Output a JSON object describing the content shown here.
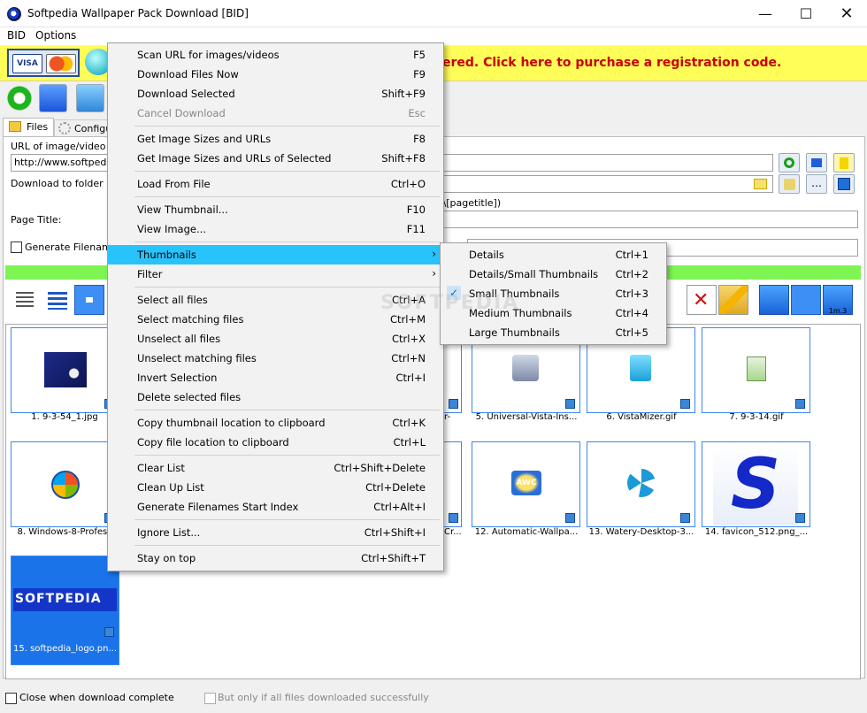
{
  "window": {
    "title": "Softpedia Wallpaper Pack Download [BID]"
  },
  "menubar": [
    "BID",
    "Options"
  ],
  "banner": {
    "text": "ered. Click here to purchase a registration code."
  },
  "tabs": {
    "files": "Files",
    "config": "Configu"
  },
  "form": {
    "url_label": "URL of image/video ga",
    "url_value": "http://www.softpedia",
    "folder_label": "Download to folder",
    "folder_pattern": "der]\\[pagetitle])",
    "page_title_label": "Page Title:",
    "generate_filenames_label": "Generate Filenames"
  },
  "thumbnails": [
    {
      "caption": "1. 9-3-54_1.jpg"
    },
    {
      "caption": "r-"
    },
    {
      "caption": "5. Universal-Vista-Ins..."
    },
    {
      "caption": "6. VistaMizer.gif"
    },
    {
      "caption": "7. 9-3-14.gif"
    },
    {
      "caption": "8. Windows-8-Profess"
    },
    {
      "caption": "Cr..."
    },
    {
      "caption": "12. Automatic-Wallpa..."
    },
    {
      "caption": "13. Watery-Desktop-3..."
    },
    {
      "caption": "14. favicon_512.png_..."
    },
    {
      "caption": "15. softpedia_logo.pn..."
    }
  ],
  "softpedia_logo_text": "SOFTPEDIA",
  "status": {
    "close_when_done": "Close when download complete",
    "only_if_success": "But only if all files downloaded successfully"
  },
  "context_menu": [
    {
      "label": "Scan URL for images/videos",
      "shortcut": "F5"
    },
    {
      "label": "Download Files Now",
      "shortcut": "F9"
    },
    {
      "label": "Download Selected",
      "shortcut": "Shift+F9"
    },
    {
      "label": "Cancel Download",
      "shortcut": "Esc"
    },
    {
      "label": "Get Image Sizes and URLs",
      "shortcut": "F8"
    },
    {
      "label": "Get Image Sizes and URLs of Selected",
      "shortcut": "Shift+F8"
    },
    {
      "label": "Load From File",
      "shortcut": "Ctrl+O"
    },
    {
      "label": "View Thumbnail...",
      "shortcut": "F10"
    },
    {
      "label": "View Image...",
      "shortcut": "F11"
    },
    {
      "label": "Thumbnails",
      "shortcut": ""
    },
    {
      "label": "Filter",
      "shortcut": ""
    },
    {
      "label": "Select all files",
      "shortcut": "Ctrl+A"
    },
    {
      "label": "Select matching files",
      "shortcut": "Ctrl+M"
    },
    {
      "label": "Unselect all files",
      "shortcut": "Ctrl+X"
    },
    {
      "label": "Unselect matching files",
      "shortcut": "Ctrl+N"
    },
    {
      "label": "Invert Selection",
      "shortcut": "Ctrl+I"
    },
    {
      "label": "Delete selected files",
      "shortcut": ""
    },
    {
      "label": "Copy thumbnail location to clipboard",
      "shortcut": "Ctrl+K"
    },
    {
      "label": "Copy file location to clipboard",
      "shortcut": "Ctrl+L"
    },
    {
      "label": "Clear List",
      "shortcut": "Ctrl+Shift+Delete"
    },
    {
      "label": "Clean Up List",
      "shortcut": "Ctrl+Delete"
    },
    {
      "label": "Generate Filenames Start Index",
      "shortcut": "Ctrl+Alt+I"
    },
    {
      "label": "Ignore List...",
      "shortcut": "Ctrl+Shift+I"
    },
    {
      "label": "Stay on top",
      "shortcut": "Ctrl+Shift+T"
    }
  ],
  "submenu": [
    {
      "label": "Details",
      "shortcut": "Ctrl+1"
    },
    {
      "label": "Details/Small Thumbnails",
      "shortcut": "Ctrl+2"
    },
    {
      "label": "Small Thumbnails",
      "shortcut": "Ctrl+3"
    },
    {
      "label": "Medium Thumbnails",
      "shortcut": "Ctrl+4"
    },
    {
      "label": "Large Thumbnails",
      "shortcut": "Ctrl+5"
    }
  ],
  "watermark": "SOFTPEDIA"
}
